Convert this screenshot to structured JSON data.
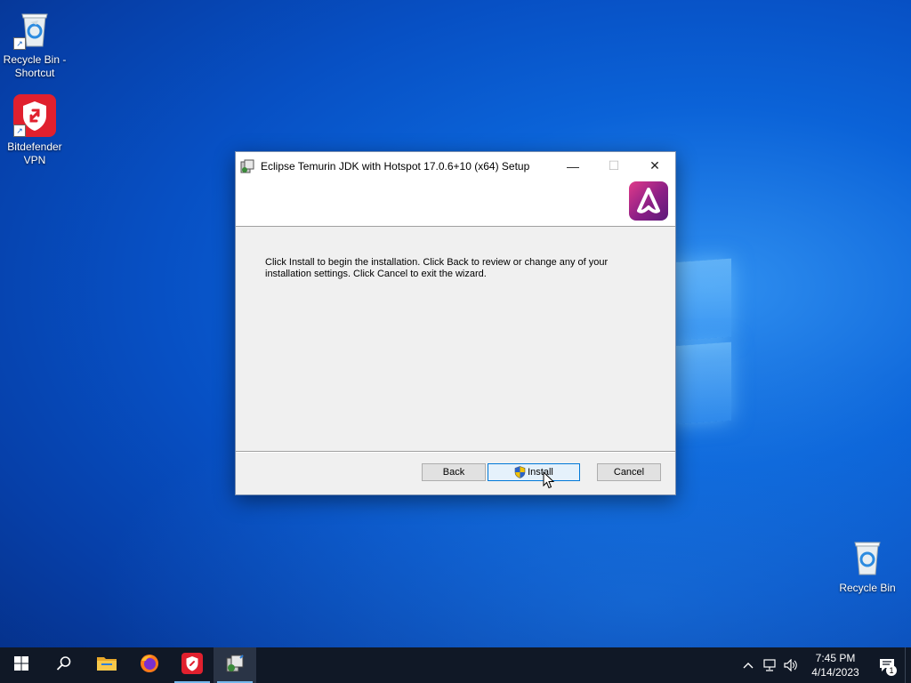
{
  "desktop": {
    "icons": [
      {
        "label": "Recycle Bin - Shortcut",
        "icon": "recycle-bin-icon",
        "shortcut": true
      },
      {
        "label": "Bitdefender VPN",
        "icon": "bitdefender-vpn-icon",
        "shortcut": true
      },
      {
        "label": "Recycle Bin",
        "icon": "recycle-bin-icon",
        "shortcut": false
      }
    ]
  },
  "dialog": {
    "title": "Eclipse Temurin JDK with Hotspot 17.0.6+10 (x64) Setup",
    "body_line1": "Click Install to begin the installation. Click Back to review or change any of your",
    "body_line2": "installation settings. Click Cancel to exit the wizard.",
    "buttons": {
      "back": "Back",
      "install": "Install",
      "cancel": "Cancel"
    },
    "controls": {
      "minimize": "—",
      "maximize": "☐",
      "close": "✕"
    }
  },
  "taskbar": {
    "apps": [
      "start-icon",
      "search-icon",
      "file-explorer-icon",
      "firefox-icon",
      "bitdefender-vpn-icon",
      "setup-installer-icon"
    ],
    "clock_time": "7:45 PM",
    "clock_date": "4/14/2023",
    "notification_count": "1",
    "tray_chevron": "^"
  },
  "colors": {
    "accent": "#0078d7",
    "taskbar": "#101826",
    "bitdefender_red": "#e0202e",
    "temurin_pink": "#c62a7f"
  }
}
